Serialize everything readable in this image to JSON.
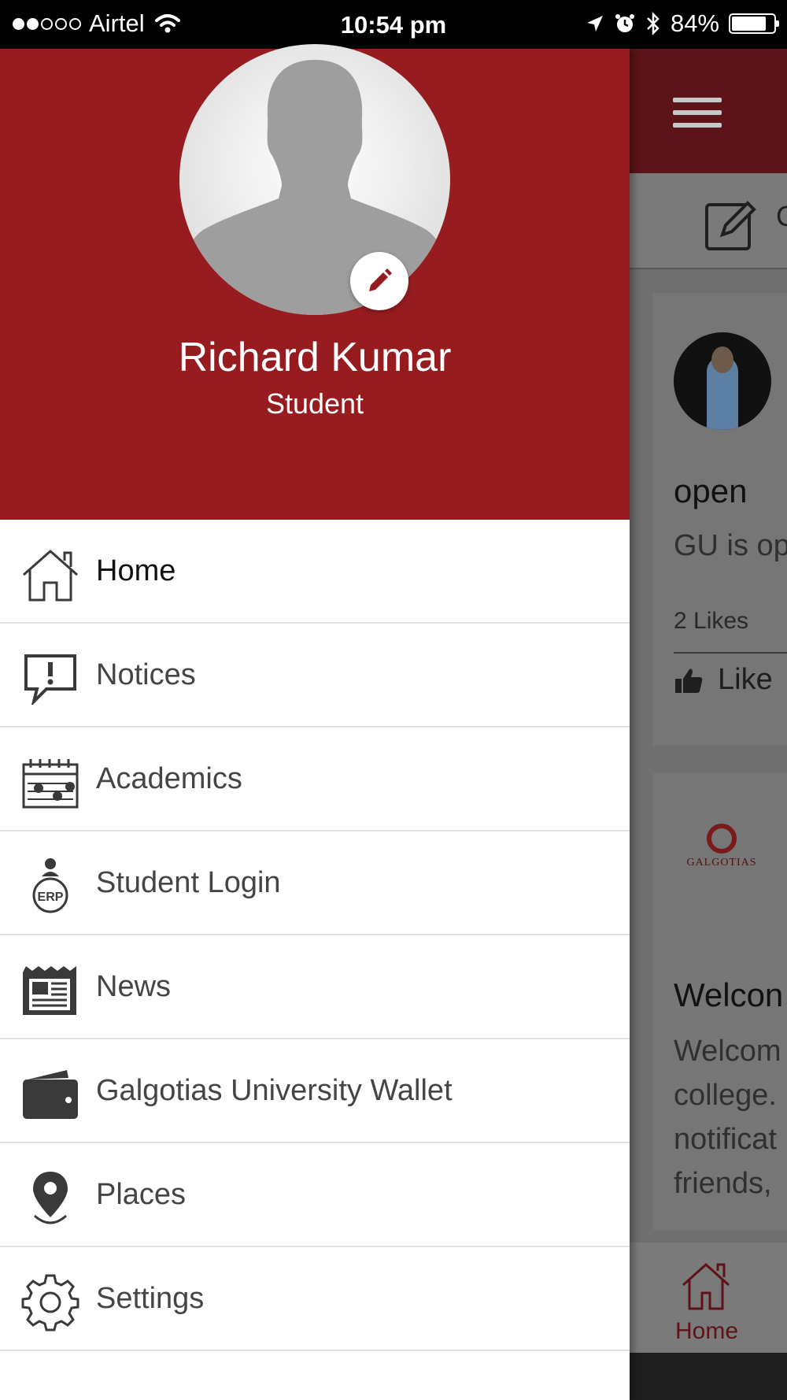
{
  "status_bar": {
    "carrier": "Airtel",
    "time": "10:54 pm",
    "battery": "84%",
    "battery_level": 0.84,
    "signal_bars_filled": 2,
    "signal_bars_total": 5
  },
  "drawer": {
    "user": {
      "name": "Richard Kumar",
      "role": "Student"
    },
    "items": [
      {
        "label": "Home",
        "icon": "home-icon",
        "active": true
      },
      {
        "label": "Notices",
        "icon": "notice-speech-icon"
      },
      {
        "label": "Academics",
        "icon": "calendar-icon"
      },
      {
        "label": "Student Login",
        "icon": "erp-user-icon"
      },
      {
        "label": "News",
        "icon": "newspaper-icon"
      },
      {
        "label": "Galgotias University Wallet",
        "icon": "wallet-icon"
      },
      {
        "label": "Places",
        "icon": "location-pin-icon"
      },
      {
        "label": "Settings",
        "icon": "gear-icon"
      }
    ]
  },
  "background_feed": {
    "compose_partial": "C",
    "post1": {
      "title": "open",
      "text": "GU is op",
      "likes": "2 Likes",
      "like_label": "Like"
    },
    "post2": {
      "logo_text": "GALGOTIAS",
      "title": "Welcon",
      "text_lines": [
        "Welcom",
        "college.",
        "notificat",
        "friends,"
      ]
    },
    "tab_home_label": "Home"
  },
  "colors": {
    "brand_red": "#961c20",
    "text": "#454545"
  }
}
